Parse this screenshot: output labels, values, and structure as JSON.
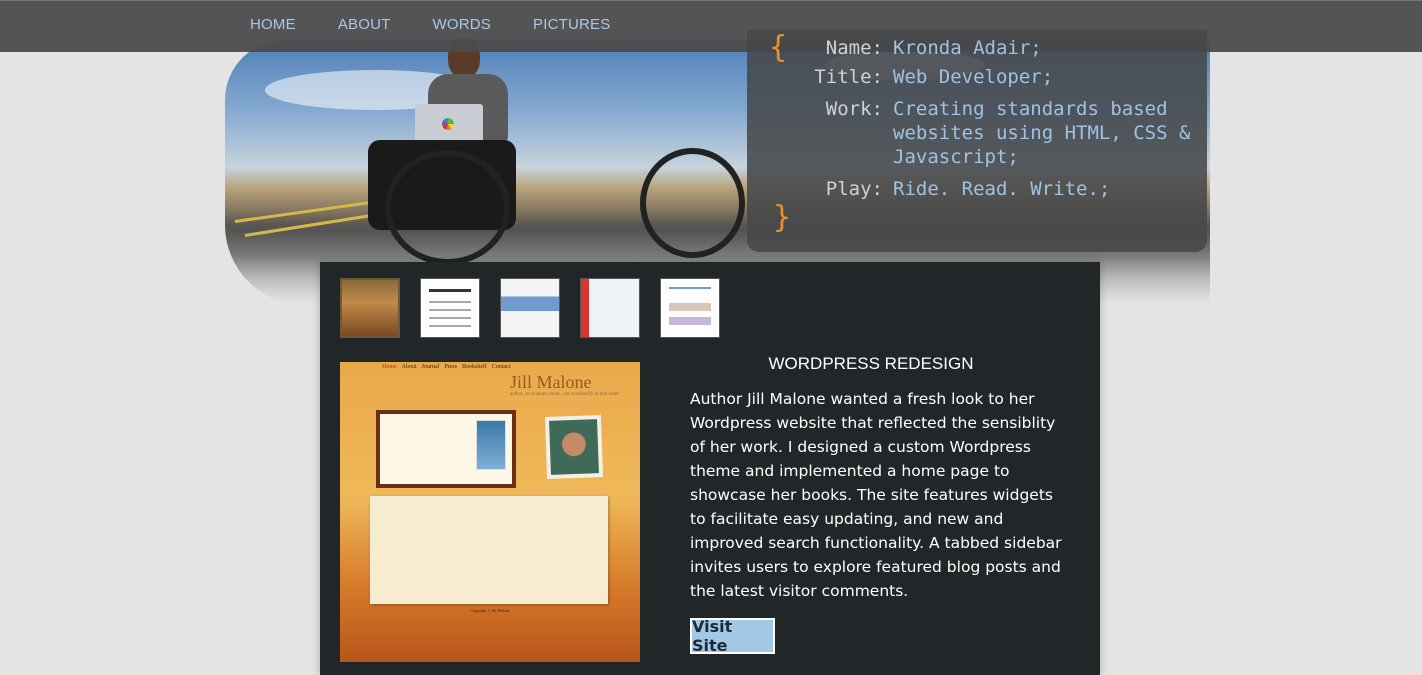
{
  "nav": {
    "items": [
      {
        "label": "HOME"
      },
      {
        "label": "ABOUT"
      },
      {
        "label": "WORDS"
      },
      {
        "label": "PICTURES"
      }
    ]
  },
  "info": {
    "open_brace": "{",
    "close_brace": "}",
    "rows": [
      {
        "key": "Name:",
        "value": "Kronda Adair;"
      },
      {
        "key": "Title:",
        "value": "Web Developer;"
      },
      {
        "key": "Work:",
        "value": "Creating standards based websites using HTML, CSS & Javascript;"
      },
      {
        "key": "Play:",
        "value": "Ride. Read. Write.;"
      }
    ]
  },
  "project": {
    "title": "WORDPRESS REDESIGN",
    "description": "Author Jill Malone wanted a fresh look to her Wordpress website that reflected the sensiblity of her work. I designed a custom Wordpress theme and implemented a home page to showcase her books. The site features widgets to facilitate easy updating, and new and improved search functionality. A tabbed sidebar invites users to explore featured blog posts and the latest visitor comments.",
    "button_label": "Visit Site"
  },
  "screenshot": {
    "nav": [
      "Home",
      "About",
      "Journal",
      "Press",
      "Bookshelf",
      "Contact"
    ],
    "site_title": "Jill Malone",
    "tagline": "author, accountant, mom...not necessarily in that order",
    "footer": "Copyright © Jill Malone"
  },
  "colors": {
    "accent_brace": "#e8912c",
    "value_text": "#9ec2e6",
    "nav_text": "#a8c8e8",
    "button_bg": "#a3c8e6",
    "content_bg": "#212629"
  }
}
